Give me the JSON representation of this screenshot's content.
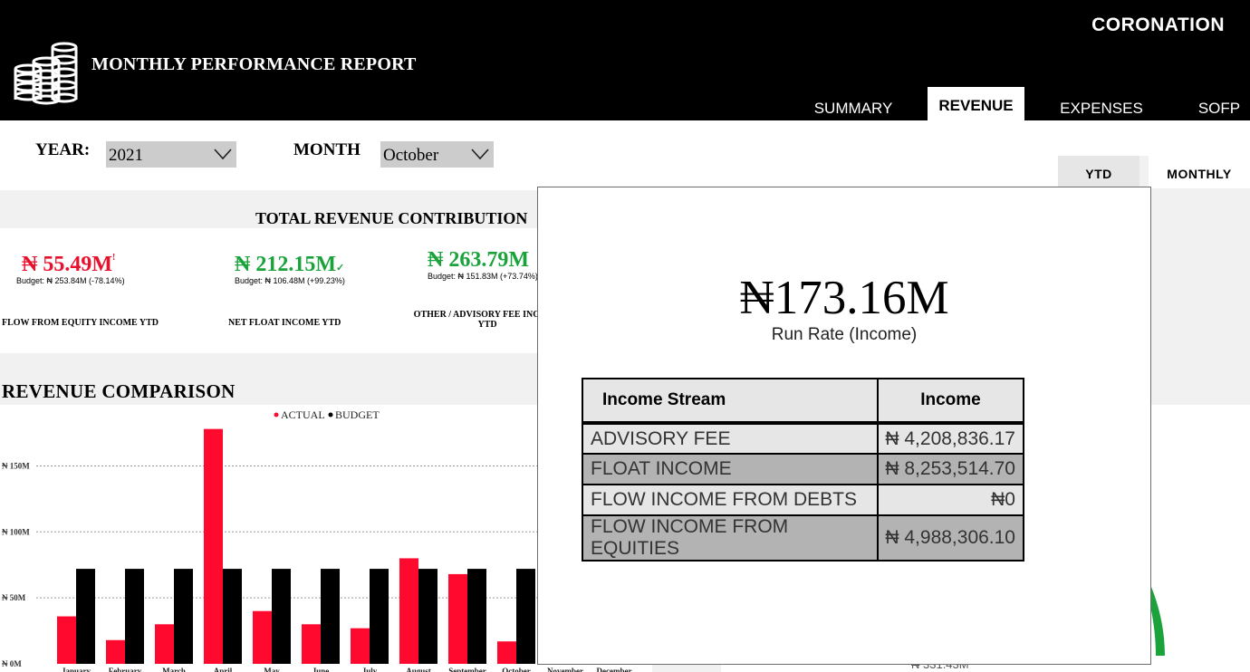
{
  "header": {
    "brand": "CORONATION",
    "title": "MONTHLY PERFORMANCE REPORT",
    "tabs": [
      "SUMMARY",
      "REVENUE",
      "EXPENSES",
      "SOFP"
    ],
    "active_tab": "REVENUE"
  },
  "filters": {
    "year_label": "YEAR:",
    "year_value": "2021",
    "month_label": "MONTH",
    "month_value": "October"
  },
  "toggle": {
    "ytd": "YTD",
    "monthly": "MONTHLY",
    "active": "MONTHLY"
  },
  "kpis": {
    "title": "TOTAL REVENUE CONTRIBUTION",
    "items": [
      {
        "value": "₦ 55.49M",
        "status_mark": "!",
        "budget": "Budget: ₦ 253.84M (-78.14%)",
        "label": "FLOW FROM EQUITY INCOME YTD"
      },
      {
        "value": "₦ 212.15M",
        "status_mark": "✓",
        "budget": "Budget: ₦ 106.48M (+99.23%)",
        "label": "NET FLOAT INCOME YTD"
      },
      {
        "value": "₦ 263.79M",
        "status_mark": "",
        "budget": "Budget: ₦ 151.83M (+73.74%)",
        "label": "OTHER / ADVISORY FEE INCOME YTD"
      }
    ],
    "colors": {
      "negative": "#e8112d",
      "positive": "#1aa33b"
    }
  },
  "comparison": {
    "title": "REVENUE COMPARISON"
  },
  "chart_data": {
    "type": "bar",
    "categories": [
      "January",
      "February",
      "March",
      "April",
      "May",
      "June",
      "July",
      "August",
      "September",
      "October",
      "November",
      "December"
    ],
    "series": [
      {
        "name": "ACTUAL",
        "color": "#ff0a2e",
        "values": [
          36,
          18,
          30,
          178,
          40,
          30,
          27,
          80,
          68,
          17,
          null,
          null
        ]
      },
      {
        "name": "BUDGET",
        "color": "#000000",
        "values": [
          72,
          72,
          72,
          72,
          72,
          72,
          72,
          72,
          72,
          72,
          null,
          null
        ]
      }
    ],
    "y_ticks": [
      "₦ 0M",
      "₦ 50M",
      "₦ 100M",
      "₦ 150M"
    ],
    "y_tick_values": [
      0,
      50,
      100,
      150
    ],
    "ylim": [
      0,
      180
    ],
    "legend_placement": "top-center",
    "grid": true
  },
  "popup": {
    "run_rate_value": "₦173.16M",
    "run_rate_label": "Run Rate (Income)",
    "table": {
      "headers": [
        "Income Stream",
        "Income"
      ],
      "rows": [
        [
          "ADVISORY FEE",
          "₦ 4,208,836.17"
        ],
        [
          "FLOAT INCOME",
          "₦ 8,253,514.70"
        ],
        [
          "FLOW INCOME FROM DEBTS",
          "₦0"
        ],
        [
          "FLOW INCOME FROM EQUITIES",
          "₦ 4,988,306.10"
        ]
      ]
    }
  },
  "background": {
    "gauge_label": "₦ 331.43M",
    "gauge_color": "#1aa33b"
  }
}
